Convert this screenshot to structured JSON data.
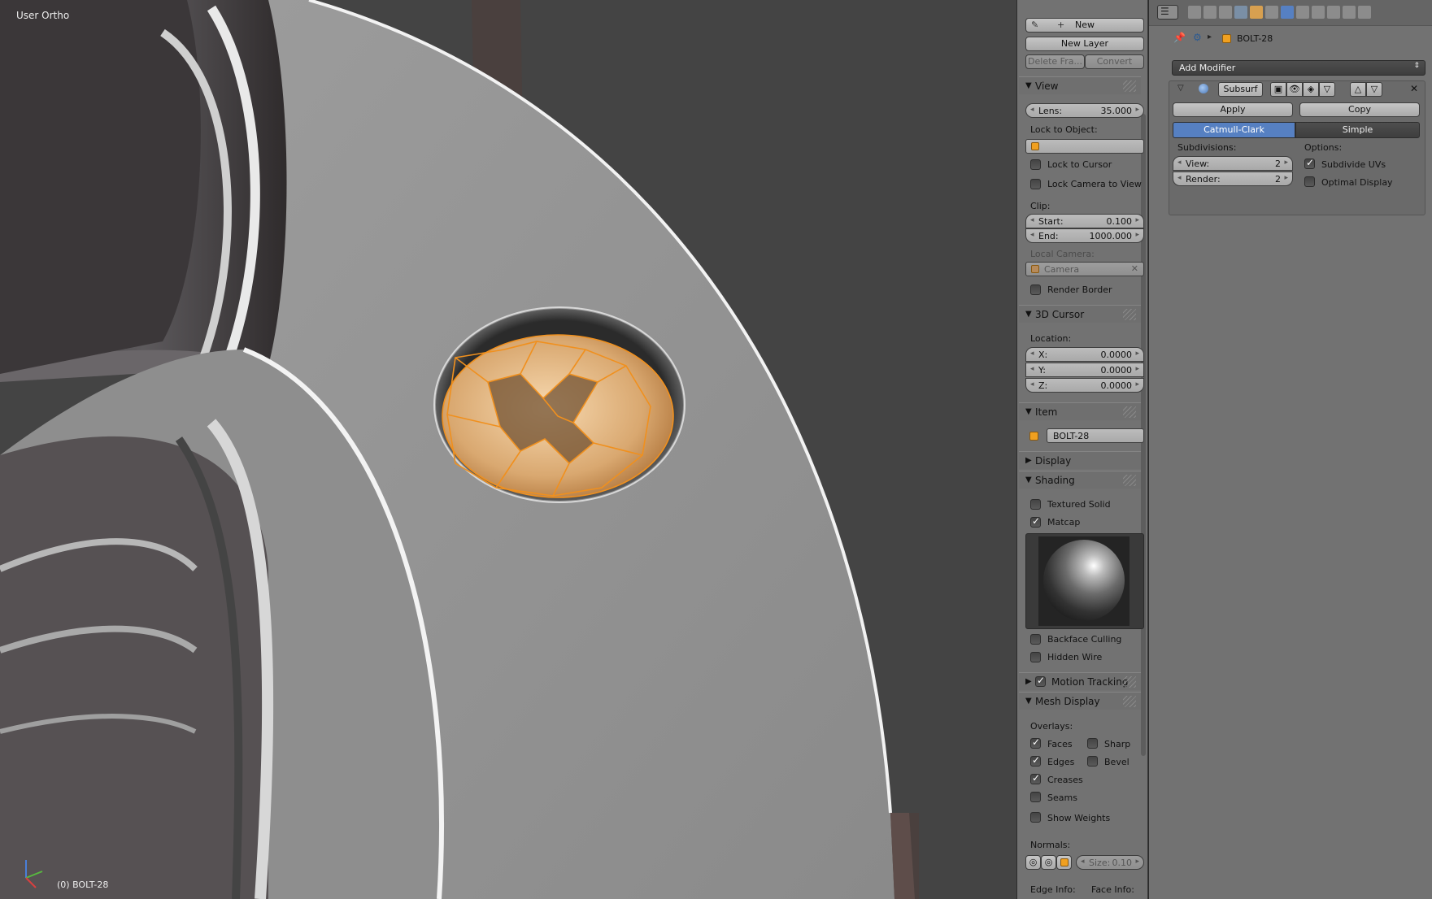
{
  "viewport": {
    "view_label": "User Ortho",
    "object_label": "(0) BOLT-28"
  },
  "gp_tools": {
    "new_label": "New",
    "new_layer_label": "New Layer",
    "delete_frame_label": "Delete Fra...",
    "convert_label": "Convert"
  },
  "view_panel": {
    "title": "View",
    "lens_key": "Lens:",
    "lens_value": "35.000",
    "lock_to_object_label": "Lock to Object:",
    "lock_to_cursor_label": "Lock to Cursor",
    "lock_camera_label": "Lock Camera to View",
    "clip_label": "Clip:",
    "start_key": "Start:",
    "start_value": "0.100",
    "end_key": "End:",
    "end_value": "1000.000",
    "local_camera_label": "Local Camera:",
    "camera_value": "Camera",
    "render_border_label": "Render Border"
  },
  "cursor_panel": {
    "title": "3D Cursor",
    "location_label": "Location:",
    "x_key": "X:",
    "x_value": "0.0000",
    "y_key": "Y:",
    "y_value": "0.0000",
    "z_key": "Z:",
    "z_value": "0.0000"
  },
  "item_panel": {
    "title": "Item",
    "name": "BOLT-28"
  },
  "display_panel": {
    "title": "Display"
  },
  "shading_panel": {
    "title": "Shading",
    "textured_solid_label": "Textured Solid",
    "textured_solid": false,
    "matcap_label": "Matcap",
    "matcap": true,
    "backface_label": "Backface Culling",
    "backface": false,
    "hidden_wire_label": "Hidden Wire",
    "hidden_wire": false
  },
  "motion_panel": {
    "title": "Motion Tracking",
    "enabled": true
  },
  "mesh_panel": {
    "title": "Mesh Display",
    "overlays_label": "Overlays:",
    "faces_label": "Faces",
    "faces": true,
    "sharp_label": "Sharp",
    "sharp": false,
    "edges_label": "Edges",
    "edges": true,
    "bevel_label": "Bevel",
    "bevel": false,
    "creases_label": "Creases",
    "creases": true,
    "seams_label": "Seams",
    "seams": false,
    "show_weights_label": "Show Weights",
    "show_weights": false,
    "normals_label": "Normals:",
    "size_key": "Size:",
    "size_value": "0.10",
    "edge_info_label": "Edge Info:",
    "face_info_label": "Face Info:"
  },
  "properties": {
    "object_name": "BOLT-28",
    "add_modifier_label": "Add Modifier",
    "modifier_name": "Subsurf",
    "apply_label": "Apply",
    "copy_label": "Copy",
    "catmull_label": "Catmull-Clark",
    "simple_label": "Simple",
    "subdivisions_label": "Subdivisions:",
    "options_label": "Options:",
    "view_key": "View:",
    "view_value": "2",
    "render_key": "Render:",
    "render_value": "2",
    "subdivide_uvs_label": "Subdivide UVs",
    "subdivide_uvs": true,
    "optimal_display_label": "Optimal Display",
    "optimal_display": false
  },
  "colors": {
    "selection": "#f0901e",
    "active_tab": "#5680c2",
    "panel_bg": "#727272"
  }
}
